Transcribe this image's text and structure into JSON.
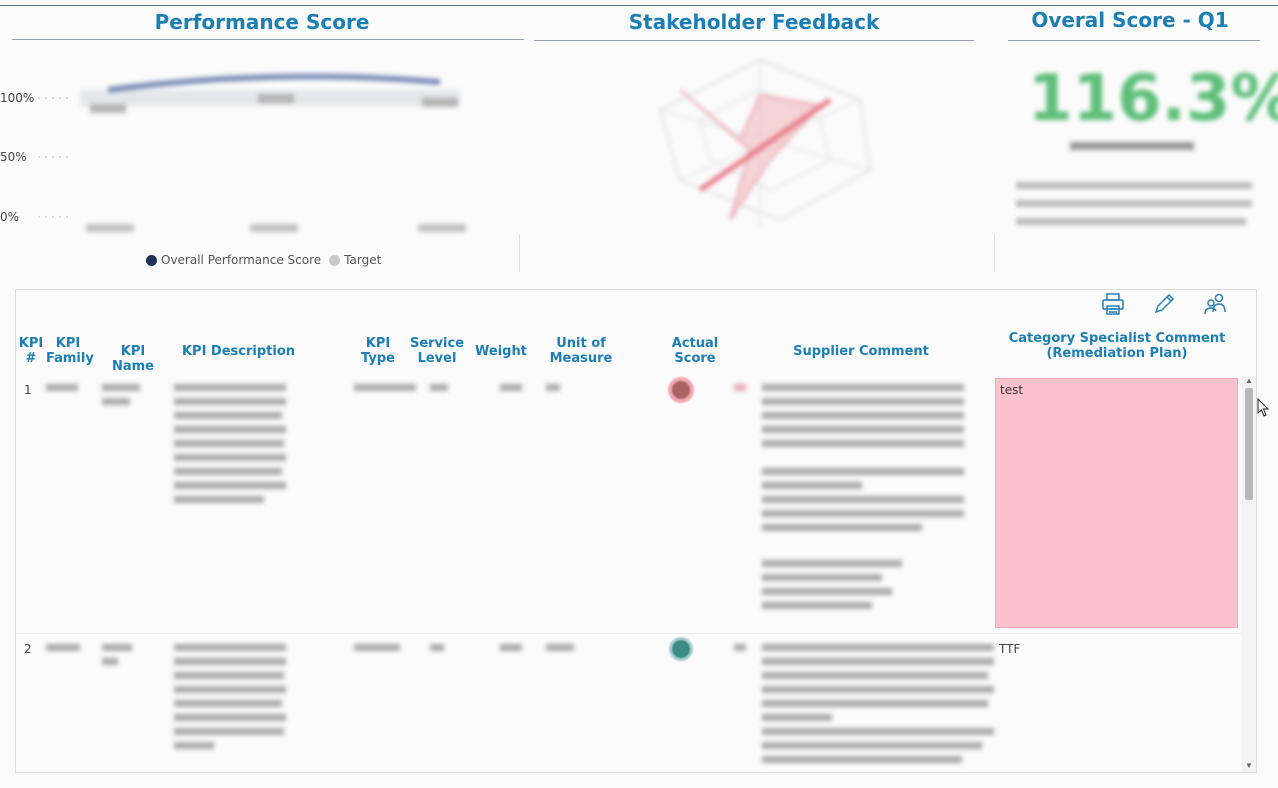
{
  "panels": {
    "performance_title": "Performance Score",
    "stakeholder_title": "Stakeholder Feedback",
    "overall_title": "Overal Score - Q1"
  },
  "performance_chart": {
    "y_ticks": [
      "100%",
      "50%",
      "0%"
    ],
    "legend": [
      {
        "label": "Overall Performance Score",
        "color": "#1f2f55"
      },
      {
        "label": "Target",
        "color": "#c9c9c9"
      }
    ]
  },
  "overall_score": {
    "value": "116.3%"
  },
  "table": {
    "headers": {
      "kpi_num": "KPI #",
      "kpi_family": "KPI Family",
      "kpi_name": "KPI Name",
      "kpi_description": "KPI Description",
      "kpi_type": "KPI Type",
      "service_level": "Service Level",
      "weight": "Weight",
      "unit": "Unit of Measure",
      "actual": "Actual Score",
      "supplier_comment": "Supplier Comment",
      "specialist_comment": "Category Specialist Comment (Remediation Plan)"
    },
    "rows": [
      {
        "num": "1",
        "specialist_comment": "test",
        "status_color": "#a96463"
      },
      {
        "num": "2",
        "specialist_comment": "TTF",
        "status_color": "#3a8a86"
      }
    ]
  },
  "toolbar": {
    "icons": [
      "print-icon",
      "edit-icon",
      "users-icon"
    ]
  }
}
